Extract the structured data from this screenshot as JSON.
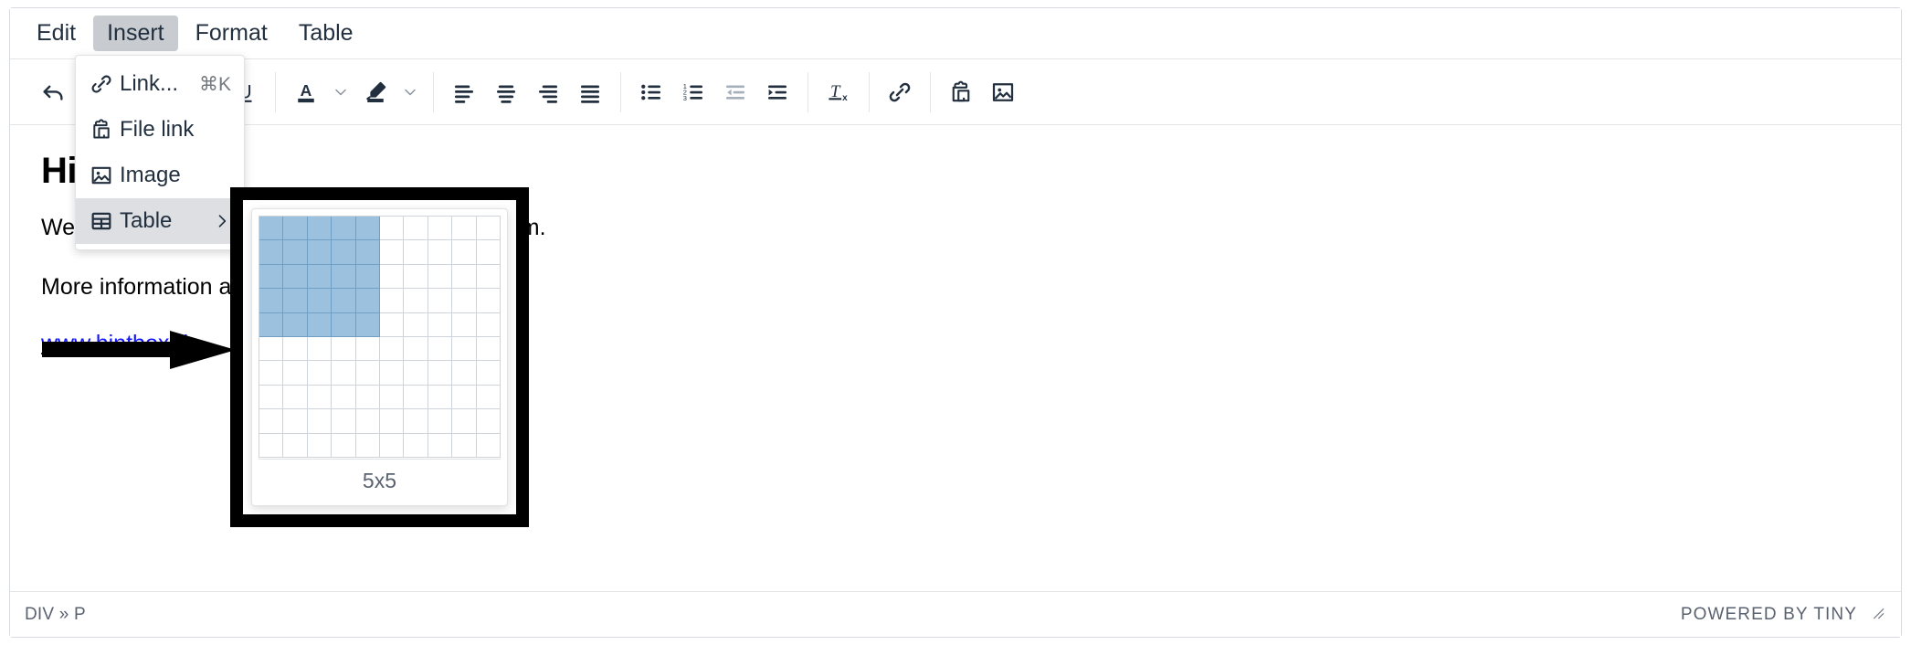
{
  "menubar": {
    "items": [
      {
        "label": "Edit",
        "name": "menubar-item-edit",
        "active": false
      },
      {
        "label": "Insert",
        "name": "menubar-item-insert",
        "active": true
      },
      {
        "label": "Format",
        "name": "menubar-item-format",
        "active": false
      },
      {
        "label": "Table",
        "name": "menubar-item-table",
        "active": false
      }
    ]
  },
  "toolbar": {
    "undo": "undo-icon",
    "blocks_caret": "chevron-down-icon",
    "bold": "bold-icon",
    "italic": "italic-icon",
    "underline": "underline-icon",
    "text_color": "text-color-icon",
    "text_color_caret": "chevron-down-icon",
    "highlight_color": "highlight-color-icon",
    "highlight_color_caret": "chevron-down-icon",
    "align_left": "align-left-icon",
    "align_center": "align-center-icon",
    "align_right": "align-right-icon",
    "align_justify": "align-justify-icon",
    "bullet_list": "bullet-list-icon",
    "numbered_list": "numbered-list-icon",
    "outdent": "outdent-icon",
    "indent": "indent-icon",
    "clear_formatting": "clear-formatting-icon",
    "insert_link": "link-icon",
    "paste": "clipboard-icon",
    "insert_image": "image-icon"
  },
  "insert_menu": {
    "items": [
      {
        "label": "Link...",
        "shortcut": "⌘K",
        "icon": "link-icon",
        "name": "insert-menu-item-link",
        "active": false,
        "submenu": false
      },
      {
        "label": "File link",
        "shortcut": "",
        "icon": "file-link-icon",
        "name": "insert-menu-item-file-link",
        "active": false,
        "submenu": false
      },
      {
        "label": "Image",
        "shortcut": "",
        "icon": "image-icon",
        "name": "insert-menu-item-image",
        "active": false,
        "submenu": false
      },
      {
        "label": "Table",
        "shortcut": "",
        "icon": "table-icon",
        "name": "insert-menu-item-table",
        "active": true,
        "submenu": true
      }
    ]
  },
  "table_picker": {
    "rows": 10,
    "cols": 10,
    "selected_rows": 5,
    "selected_cols": 5,
    "size_label": "5x5",
    "selected_color": "#9cc1de",
    "grid_line_color": "#cfd4da"
  },
  "document": {
    "heading": "Hintbox",
    "paragraph": "We are happy to welcome you to our new system.",
    "paragraph_prefix": "We",
    "paragraph_suffix": "system.",
    "more_info_text": "More information at",
    "link_text": "www.hintbox.de",
    "link_color": "#1414ff"
  },
  "statusbar": {
    "element_path": "DIV » P",
    "brand": "POWERED BY TINY",
    "resize_handle": "resize-handle-icon"
  },
  "annotations": {
    "arrow": "arrow-right-annotation",
    "box": "highlight-box-annotation"
  }
}
